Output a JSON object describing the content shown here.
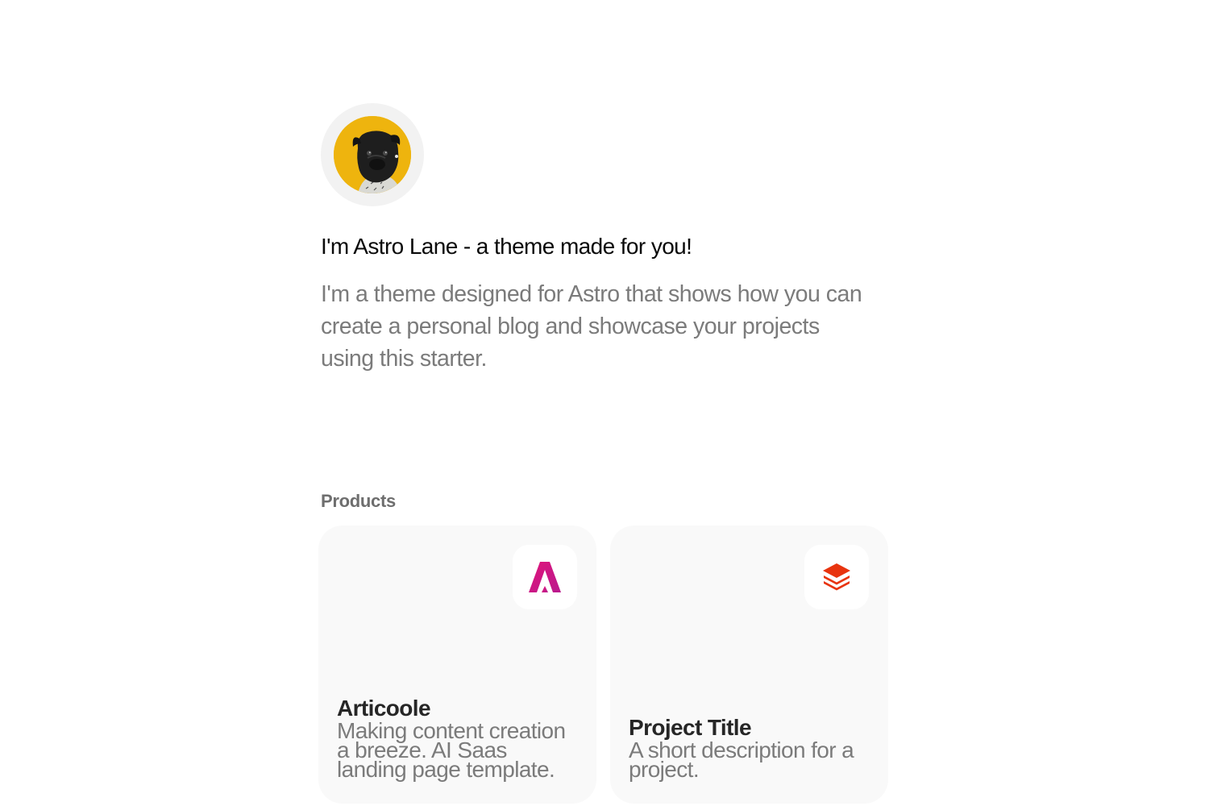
{
  "profile": {
    "avatar_icon": "pug-avatar-icon",
    "avatar_color": "#eeb40e"
  },
  "hero": {
    "title": "I'm Astro Lane - a theme made for you!",
    "description": "I'm a theme designed for Astro that shows how you can create a personal blog and showcase your projects using this starter."
  },
  "products": {
    "label": "Products",
    "items": [
      {
        "title": "Articoole",
        "description": "Making content creation a breeze. AI Saas landing page template.",
        "icon": "articoole-logo-icon",
        "accent": "#d3177c"
      },
      {
        "title": "Project Title",
        "description": "A short description for a project.",
        "icon": "stack-layers-icon",
        "accent": "#e8340f"
      }
    ]
  }
}
